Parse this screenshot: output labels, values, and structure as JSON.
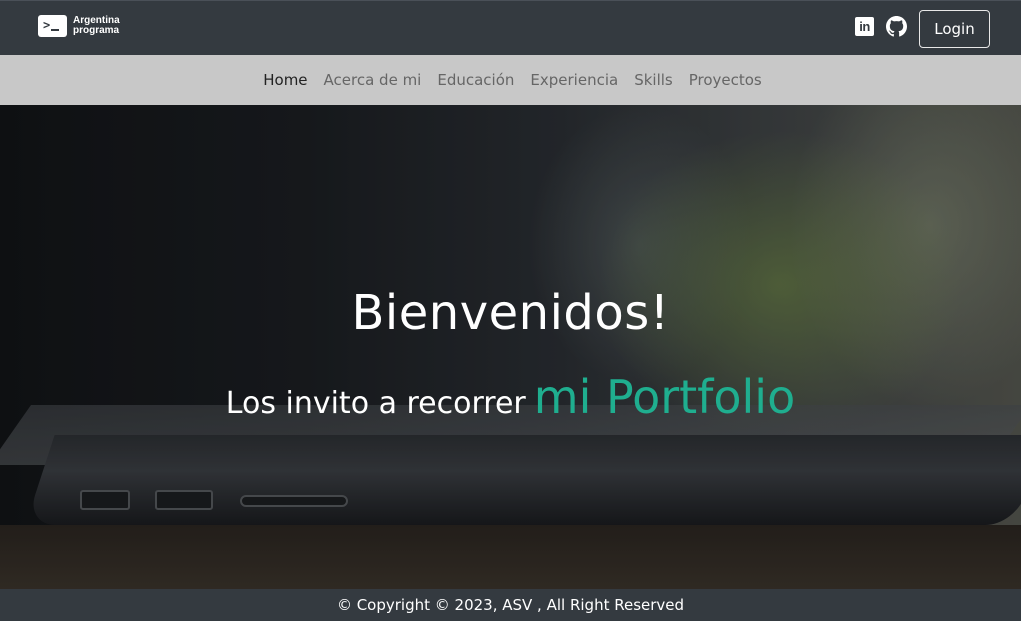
{
  "header": {
    "logo_line1": "Argentina",
    "logo_line2": "programa",
    "login_label": "Login",
    "social_icons": [
      "linkedin-icon",
      "github-icon"
    ]
  },
  "nav": {
    "items": [
      {
        "label": "Home",
        "active": true
      },
      {
        "label": "Acerca de mi",
        "active": false
      },
      {
        "label": "Educación",
        "active": false
      },
      {
        "label": "Experiencia",
        "active": false
      },
      {
        "label": "Skills",
        "active": false
      },
      {
        "label": "Proyectos",
        "active": false
      }
    ]
  },
  "hero": {
    "title": "Bienvenidos!",
    "subtitle_lead": "Los invito a recorrer",
    "subtitle_accent": "mi Portfolio",
    "accent_color": "#1fae8f"
  },
  "footer": {
    "text": "© Copyright © 2023, ASV , All Right Reserved"
  },
  "colors": {
    "topbar": "#343a40",
    "navbar": "#c8c8c8"
  }
}
